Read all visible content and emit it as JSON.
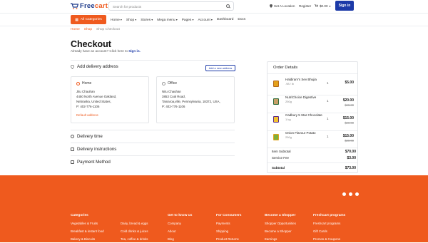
{
  "brand": {
    "part1": "Free",
    "part2": "cart",
    "accent": "#ef5a1e",
    "primary": "#1c3aa8"
  },
  "search": {
    "placeholder": "Search for products"
  },
  "top_right": {
    "location": "Set A Location",
    "register": "Register",
    "cart": "$0.00",
    "signin": "Sign in"
  },
  "nav": {
    "all_categories": "All Categories",
    "items": [
      "Home",
      "Shop",
      "Stores",
      "Mega menu",
      "Pages",
      "Account",
      "Dashboard",
      "Docs"
    ]
  },
  "breadcrumb": [
    "Home",
    "Shop",
    "Shop Checkout"
  ],
  "page": {
    "title": "Checkout",
    "subtitle": "Already have an account? Click here to",
    "signin_link": "Sign in."
  },
  "delivery": {
    "title": "Add delivery address",
    "add_button": "Add a new address",
    "addresses": [
      {
        "label": "Home",
        "name": "Jitu Chauhan",
        "line1": "4450 North Avenue Oakland,",
        "line2": "Nebraska, United States,",
        "phone": "P: 402-776-1106",
        "default": "Default address",
        "selected": true
      },
      {
        "label": "Office",
        "name": "Nitu Chauhan",
        "line1": "3853 Coal Road,",
        "line2": "Tamaroa,ville, Pennsylvania, 18372, USA,",
        "phone": "P: 402-776-1106",
        "selected": false
      }
    ]
  },
  "sections": {
    "time": "Delivery time",
    "instructions": "Delivery instructions",
    "payment": "Payment Method"
  },
  "order": {
    "title": "Order Details",
    "items": [
      {
        "name": "Haldiram's Sev Bhujia",
        "weight": ".98 / lb",
        "qty": "1",
        "price": "$5.00",
        "old": ""
      },
      {
        "name": "NutriChoice Digestive",
        "weight": "250g",
        "qty": "1",
        "price": "$20.00",
        "old": "$28.00"
      },
      {
        "name": "Cadbury 5 Star Chocolate",
        "weight": "1 kg",
        "qty": "1",
        "price": "$15.00",
        "old": "$20.00"
      },
      {
        "name": "Onion Flavour Potato",
        "weight": "250g",
        "qty": "1",
        "price": "$15.00",
        "old": "$20.00"
      }
    ],
    "item_subtotal_label": "Item Subtotal",
    "item_subtotal": "$70.00",
    "service_fee_label": "Service Fee",
    "service_fee": "$3.00",
    "subtotal_label": "Subtotal",
    "subtotal": "$73.00"
  },
  "footer": {
    "columns": [
      {
        "heading": "Categories",
        "links": [
          "Vegetables & Fruits",
          "Breakfast & instant food",
          "Bakery & Biscuits"
        ]
      },
      {
        "heading": "",
        "links": [
          "Dairy, bread & eggs",
          "Cold drinks & juices",
          "Tea, coffee & drinks"
        ]
      },
      {
        "heading": "Get to know us",
        "links": [
          "Company",
          "About",
          "Blog"
        ]
      },
      {
        "heading": "For Consumers",
        "links": [
          "Payments",
          "Shipping",
          "Product Returns"
        ]
      },
      {
        "heading": "Become a Shopper",
        "links": [
          "Shopper Opportunities",
          "Become a Shopper",
          "Earnings"
        ]
      },
      {
        "heading": "Freshcart programs",
        "links": [
          "Freshcart programs",
          "Gift Cards",
          "Promos & Coupons"
        ]
      }
    ],
    "social_icons": [
      "facebook-icon",
      "twitter-icon",
      "instagram-icon"
    ]
  }
}
